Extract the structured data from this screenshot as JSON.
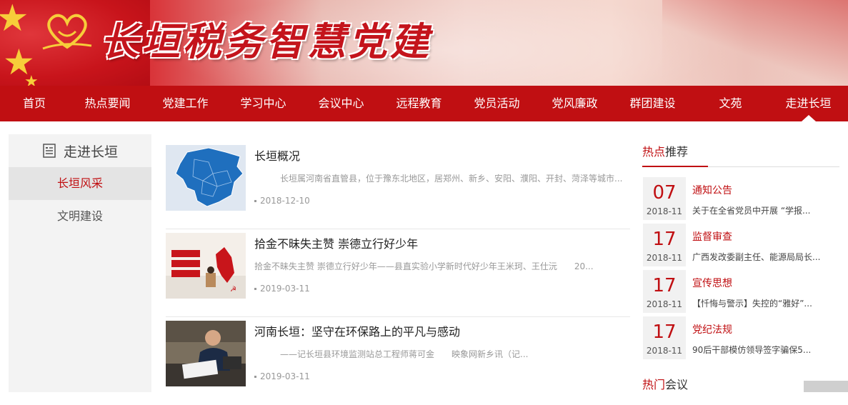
{
  "banner": {
    "title": "长垣税务智慧党建"
  },
  "nav": {
    "items": [
      "首页",
      "热点要闻",
      "党建工作",
      "学习中心",
      "会议中心",
      "远程教育",
      "党员活动",
      "党风廉政",
      "群团建设",
      "文苑",
      "走进长垣"
    ],
    "active": "走进长垣"
  },
  "sidebar": {
    "heading": "走进长垣",
    "items": [
      {
        "label": "长垣风采",
        "active": true
      },
      {
        "label": "文明建设",
        "active": false
      }
    ]
  },
  "articles": [
    {
      "title": "长垣概况",
      "summary": "长垣属河南省直管县，位于豫东北地区，居郑州、新乡、安阳、濮阳、开封、菏泽等城市...",
      "date": "2018-12-10"
    },
    {
      "title": "拾金不昧失主赞 崇德立行好少年",
      "summary": "拾金不昧失主赞 崇德立行好少年——县直实验小学新时代好少年王米珂、王仕沅　　20...",
      "date": "2019-03-11"
    },
    {
      "title": "河南长垣：坚守在环保路上的平凡与感动",
      "summary": "——记长垣县环境监测站总工程师蒋可金　　映象网新乡讯（记...",
      "date": "2019-03-11"
    }
  ],
  "hot": {
    "title_highlight": "热点",
    "title_rest": "推荐",
    "items": [
      {
        "day": "07",
        "ym": "2018-11",
        "category": "通知公告",
        "summary": "关于在全省党员中开展 “学报..."
      },
      {
        "day": "17",
        "ym": "2018-11",
        "category": "监督审查",
        "summary": "广西发改委副主任、能源局局长..."
      },
      {
        "day": "17",
        "ym": "2018-11",
        "category": "宣传思想",
        "summary": "【忏悔与警示】失控的“雅好”..."
      },
      {
        "day": "17",
        "ym": "2018-11",
        "category": "党纪法规",
        "summary": "90后干部模仿领导签字骗保5..."
      }
    ]
  },
  "meeting": {
    "title_highlight": "热门",
    "title_rest": "会议"
  },
  "colors": {
    "brand_red": "#c00f12",
    "gold": "#f7cd3a"
  },
  "icons": {
    "sidebar_heading": "document-list-icon",
    "logo": "heart-logo-icon"
  }
}
